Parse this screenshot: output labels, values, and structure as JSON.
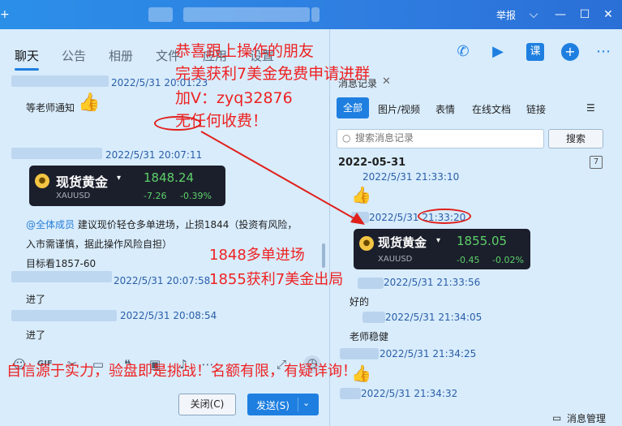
{
  "titlebar": {
    "report_label": "举报",
    "controls": {
      "dropdown": "⌵",
      "minimize": "—",
      "maximize": "☐",
      "close": "✕"
    }
  },
  "tabs": [
    "聊天",
    "公告",
    "相册",
    "文件",
    "应用",
    "设置"
  ],
  "left_chat": {
    "messages": [
      {
        "stamp": "2022/5/31 20:01:23",
        "text": "等老师通知",
        "emoji": "👍"
      },
      {
        "stamp": "2022/5/31 20:07:11"
      },
      {
        "mention": "@全体成员",
        "text_line1": " 建议现价轻仓多单进场，止损1844（投资有风险，",
        "text_line2": "入市需谨慎，据此操作风险自担）",
        "text_line3": "目标看1857-60"
      },
      {
        "stamp": "2022/5/31 20:07:58",
        "text": "进了"
      },
      {
        "stamp": "2022/5/31 20:08:54",
        "text": "进了"
      }
    ],
    "gold_card": {
      "name": "现货黄金",
      "code": "XAUUSD",
      "price": "1848.24",
      "change": "-7.26",
      "change_pct": "-0.39%"
    }
  },
  "toolbar_icons": [
    "emoji-icon",
    "gif-icon",
    "scissors-icon",
    "folder-icon",
    "quote-icon",
    "image-icon",
    "bell-icon",
    "more-icon",
    "expand-icon",
    "history-icon"
  ],
  "buttons": {
    "close": "关闭(C)",
    "send": "发送(S)",
    "send_caret": "⌄"
  },
  "history": {
    "title": "消息记录",
    "close": "✕",
    "filters": [
      "全部",
      "图片/视频",
      "表情",
      "在线文档",
      "链接"
    ],
    "search_placeholder": "搜索消息记录",
    "search_button": "搜索",
    "date": "2022-05-31",
    "calendar_day": "7",
    "entries": [
      {
        "stamp": "2022/5/31 21:33:10"
      },
      {
        "stamp": "2022/5/31 21:33:20"
      },
      {
        "stamp": "2022/5/31 21:33:56",
        "text": "好的"
      },
      {
        "stamp": "2022/5/31 21:34:05",
        "text": "老师稳健"
      },
      {
        "stamp": "2022/5/31 21:34:25"
      },
      {
        "stamp": "2022/5/31 21:34:32"
      }
    ],
    "gold_card": {
      "name": "现货黄金",
      "code": "XAUUSD",
      "price": "1855.05",
      "change": "-0.45",
      "change_pct": "-0.02%"
    },
    "management": "消息管理"
  },
  "overlay_text": {
    "line1": "恭喜跟上操作的朋友",
    "line2": "完美获利7美金免费申请进群",
    "line3": "加V：zyq32876",
    "line4": "无任何收费！",
    "mid1": "1848多单进场",
    "mid2": "1855获利7美金出局",
    "bottom": "自信源于实力，验盘即是挑战！名额有限，有疑详询！"
  },
  "colors": {
    "titlebar": "#2b8fe8",
    "accent": "#1e7fe0",
    "overlay_red": "#ee2222",
    "gold_green": "#5dd06a"
  }
}
